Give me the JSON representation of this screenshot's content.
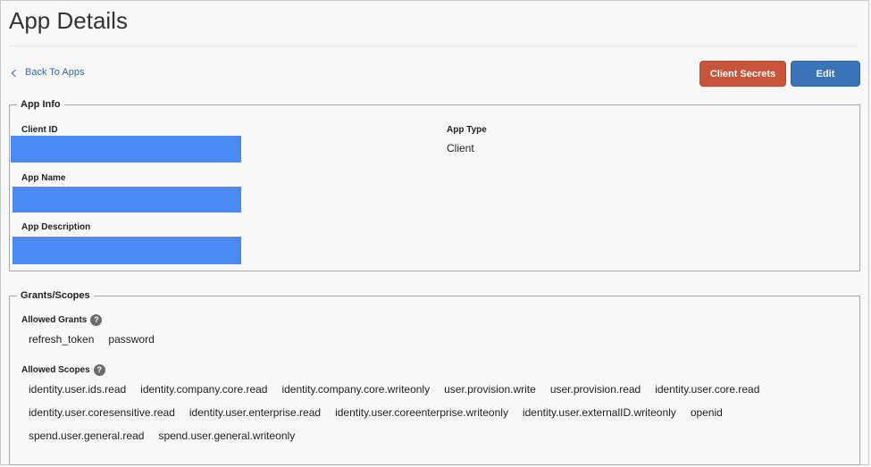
{
  "header": {
    "title": "App Details"
  },
  "toolbar": {
    "back_label": "Back To Apps",
    "client_secrets_label": "Client Secrets",
    "edit_label": "Edit"
  },
  "app_info": {
    "legend": "App Info",
    "client_id_label": "Client ID",
    "app_name_label": "App Name",
    "app_description_label": "App Description",
    "app_type_label": "App Type",
    "app_type_value": "Client"
  },
  "grants": {
    "legend": "Grants/Scopes",
    "allowed_grants_label": "Allowed Grants",
    "allowed_grants": [
      "refresh_token",
      "password"
    ],
    "allowed_scopes_label": "Allowed Scopes",
    "scope_rows": [
      [
        "identity.user.ids.read",
        "identity.company.core.read",
        "identity.company.core.writeonly",
        "user.provision.write",
        "user.provision.read",
        "identity.user.core.read"
      ],
      [
        "identity.user.coresensitive.read",
        "identity.user.enterprise.read",
        "identity.user.coreenterprise.writeonly",
        "identity.user.externalID.writeonly",
        "openid"
      ],
      [
        "spend.user.general.read",
        "spend.user.general.writeonly"
      ]
    ]
  },
  "icons": {
    "help": "question-circle-icon",
    "back": "chevron-left-icon"
  },
  "colors": {
    "link": "#2b6cb0",
    "secrets_button": "#c8553b",
    "edit_button": "#3a73b7",
    "redaction": "#4a8af4"
  }
}
